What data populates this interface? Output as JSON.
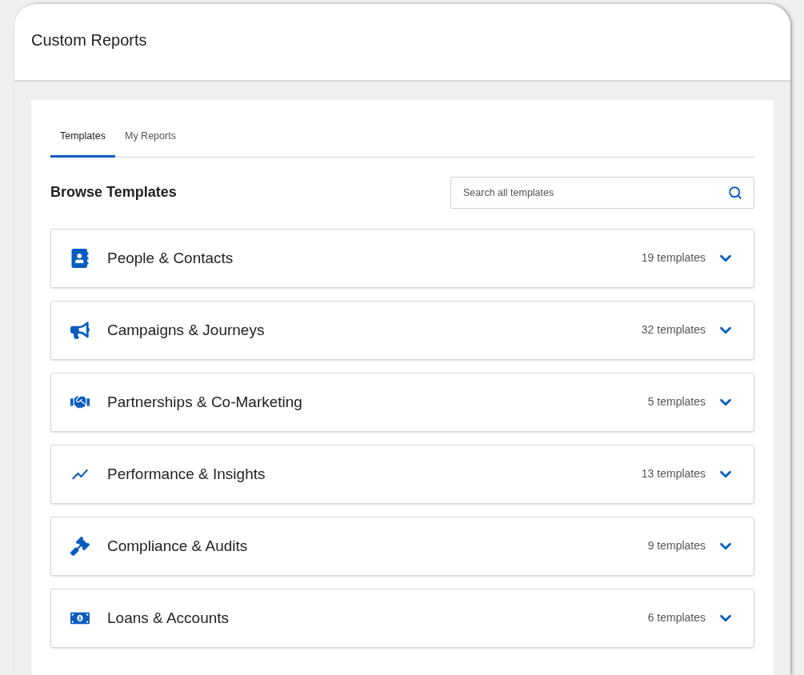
{
  "header": {
    "title": "Custom Reports"
  },
  "tabs": [
    {
      "label": "Templates",
      "selected": true
    },
    {
      "label": "My Reports",
      "selected": false
    }
  ],
  "section_title": "Browse Templates",
  "search": {
    "placeholder": "Search all templates"
  },
  "categories": [
    {
      "kind": "contacts",
      "name": "People & Contacts",
      "count": "19 templates",
      "expanded": false
    },
    {
      "kind": "megaphone",
      "name": "Campaigns & Journeys",
      "count": "32 templates",
      "expanded": false
    },
    {
      "kind": "handshake",
      "name": "Partnerships & Co-Marketing",
      "count": "5 templates",
      "expanded": false
    },
    {
      "kind": "chart",
      "name": "Performance & Insights",
      "count": "13 templates",
      "expanded": false
    },
    {
      "kind": "gavel",
      "name": "Compliance & Audits",
      "count": "9 templates",
      "expanded": false
    },
    {
      "kind": "money",
      "name": "Loans & Accounts",
      "count": "6 templates",
      "expanded": false
    }
  ]
}
